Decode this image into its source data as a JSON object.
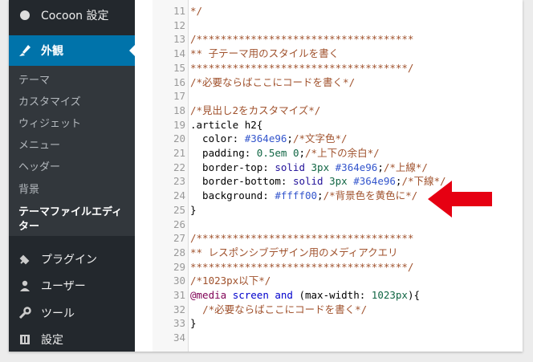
{
  "sidebar": {
    "top_item": {
      "label": "Cocoon 設定",
      "icon": "circle-icon"
    },
    "active_item": {
      "label": "外観",
      "icon": "paintbrush-icon"
    },
    "submenu": [
      {
        "label": "テーマ"
      },
      {
        "label": "カスタマイズ"
      },
      {
        "label": "ウィジェット"
      },
      {
        "label": "メニュー"
      },
      {
        "label": "ヘッダー"
      },
      {
        "label": "背景"
      },
      {
        "label": "テーマファイルエディ"
      },
      {
        "label": "ター"
      }
    ],
    "items": [
      {
        "label": "プラグイン",
        "icon": "plugin-icon"
      },
      {
        "label": "ユーザー",
        "icon": "user-icon"
      },
      {
        "label": "ツール",
        "icon": "wrench-icon"
      },
      {
        "label": "設定",
        "icon": "settings-icon"
      }
    ]
  },
  "editor": {
    "lines": [
      {
        "n": "11",
        "t": "*/"
      },
      {
        "n": "12",
        "t": ""
      },
      {
        "n": "13",
        "t": "/************************************"
      },
      {
        "n": "14",
        "t": "** 子テーマ用のスタイルを書く"
      },
      {
        "n": "15",
        "t": "************************************/"
      },
      {
        "n": "16",
        "t": "/*必要ならばここにコードを書く*/"
      },
      {
        "n": "17",
        "t": ""
      },
      {
        "n": "18",
        "t": "/*見出し2をカスタマイズ*/"
      },
      {
        "n": "19",
        "t": ".article h2{"
      },
      {
        "n": "20",
        "t": "  color: #364e96;/*文字色*/"
      },
      {
        "n": "21",
        "t": "  padding: 0.5em 0;/*上下の余白*/"
      },
      {
        "n": "22",
        "t": "  border-top: solid 3px #364e96;/*上線*/"
      },
      {
        "n": "23",
        "t": "  border-bottom: solid 3px #364e96;/*下線*/"
      },
      {
        "n": "24",
        "t": "  background: #ffff00;/*背景色を黄色に*/"
      },
      {
        "n": "25",
        "t": "}"
      },
      {
        "n": "26",
        "t": ""
      },
      {
        "n": "27",
        "t": "/************************************"
      },
      {
        "n": "28",
        "t": "** レスポンシブデザイン用のメディアクエリ"
      },
      {
        "n": "29",
        "t": "************************************/"
      },
      {
        "n": "30",
        "t": "/*1023px以下*/"
      },
      {
        "n": "31",
        "t": "@media screen and (max-width: 1023px){"
      },
      {
        "n": "32",
        "t": "  /*必要ならばここにコードを書く*/"
      },
      {
        "n": "33",
        "t": "}"
      },
      {
        "n": "34",
        "t": ""
      }
    ]
  },
  "annotation": {
    "icon": "red-arrow-icon",
    "color": "#e60012"
  }
}
